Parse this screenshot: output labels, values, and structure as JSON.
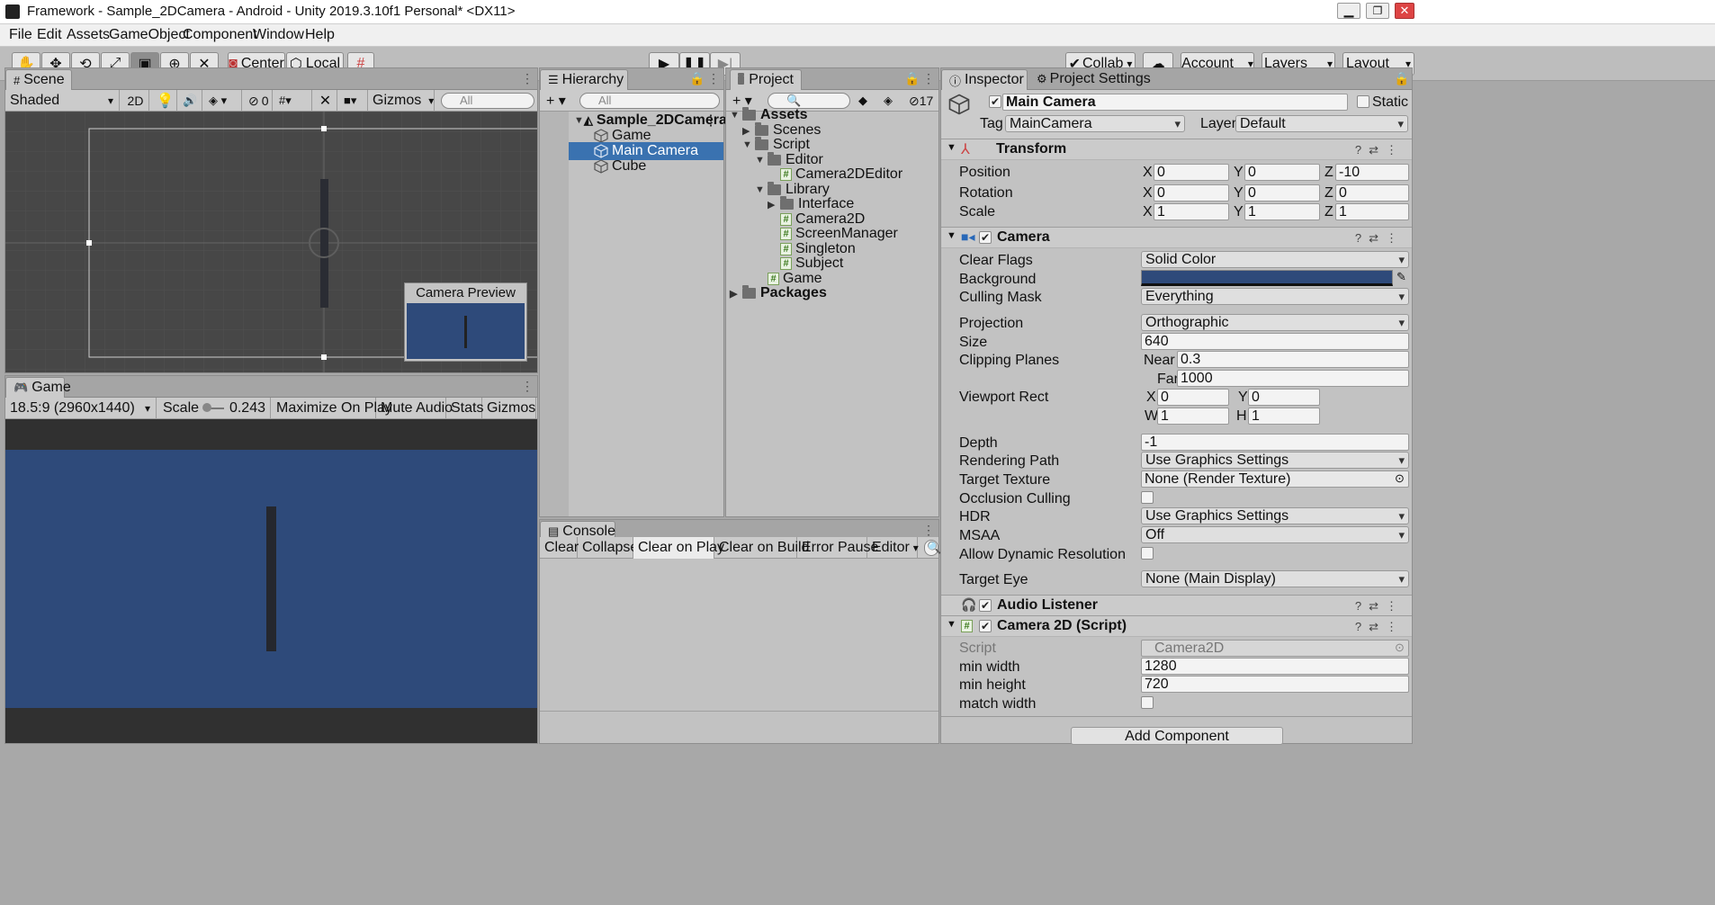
{
  "window": {
    "title": "Framework - Sample_2DCamera - Android - Unity 2019.3.10f1 Personal* <DX11>"
  },
  "menu": [
    "File",
    "Edit",
    "Assets",
    "GameObject",
    "Component",
    "Window",
    "Help"
  ],
  "toolbar": {
    "center_label": "Center",
    "local_label": "Local",
    "collab_label": "Collab",
    "account_label": "Account",
    "layers_label": "Layers",
    "layout_label": "Layout"
  },
  "scene": {
    "tab": "Scene",
    "shading": "Shaded",
    "two_d": "2D",
    "hidden_count": "0",
    "gizmos": "Gizmos",
    "search_placeholder": "All",
    "preview_title": "Camera Preview"
  },
  "game": {
    "tab": "Game",
    "resolution": "18.5:9 (2960x1440)",
    "scale_label": "Scale",
    "scale_value": "0.243",
    "maximize": "Maximize On Play",
    "mute": "Mute Audio",
    "stats": "Stats",
    "gizmos": "Gizmos"
  },
  "hierarchy": {
    "tab": "Hierarchy",
    "search_placeholder": "All",
    "scene_name": "Sample_2DCamera",
    "items": [
      "Game",
      "Main Camera",
      "Cube"
    ]
  },
  "project": {
    "tab": "Project",
    "hidden_count": "17",
    "items": [
      "Assets",
      "Scenes",
      "Script",
      "Editor",
      "Camera2DEditor",
      "Library",
      "Interface",
      "Camera2D",
      "ScreenManager",
      "Singleton",
      "Subject",
      "Game",
      "Packages"
    ]
  },
  "console": {
    "tab": "Console",
    "buttons": [
      "Clear",
      "Collapse",
      "Clear on Play",
      "Clear on Build",
      "Error Pause",
      "Editor"
    ]
  },
  "inspector": {
    "tab": "Inspector",
    "tab2": "Project Settings",
    "object_name": "Main Camera",
    "static_label": "Static",
    "tag_label": "Tag",
    "tag_value": "MainCamera",
    "layer_label": "Layer",
    "layer_value": "Default",
    "transform": {
      "title": "Transform",
      "position": "Position",
      "rotation": "Rotation",
      "scale": "Scale",
      "pos": [
        "0",
        "0",
        "-10"
      ],
      "rot": [
        "0",
        "0",
        "0"
      ],
      "scl": [
        "1",
        "1",
        "1"
      ],
      "axes": [
        "X",
        "Y",
        "Z"
      ]
    },
    "camera": {
      "title": "Camera",
      "clear_flags": "Clear Flags",
      "clear_flags_value": "Solid Color",
      "background": "Background",
      "background_color": "#2e4a7a",
      "culling": "Culling Mask",
      "culling_value": "Everything",
      "projection": "Projection",
      "projection_value": "Orthographic",
      "size": "Size",
      "size_value": "640",
      "clipping": "Clipping Planes",
      "near_label": "Near",
      "near_value": "0.3",
      "far_label": "Far",
      "far_value": "1000",
      "viewport": "Viewport Rect",
      "vx": "0",
      "vy": "0",
      "vw": "1",
      "vh": "1",
      "vlabels": [
        "X",
        "Y",
        "W",
        "H"
      ],
      "depth": "Depth",
      "depth_value": "-1",
      "rendering": "Rendering Path",
      "rendering_value": "Use Graphics Settings",
      "target_texture": "Target Texture",
      "target_texture_value": "None (Render Texture)",
      "occlusion": "Occlusion Culling",
      "hdr": "HDR",
      "hdr_value": "Use Graphics Settings",
      "msaa": "MSAA",
      "msaa_value": "Off",
      "dynamic": "Allow Dynamic Resolution",
      "target_eye": "Target Eye",
      "target_eye_value": "None (Main Display)"
    },
    "audio": {
      "title": "Audio Listener"
    },
    "script": {
      "title": "Camera 2D (Script)",
      "script_label": "Script",
      "script_value": "Camera2D",
      "min_width": "min width",
      "min_width_value": "1280",
      "min_height": "min height",
      "min_height_value": "720",
      "match_width": "match width"
    },
    "add_component": "Add Component"
  },
  "colors": {
    "game_bg": "#2e4a7a",
    "selection": "#3a72b0",
    "scene_bg": "#474747"
  }
}
